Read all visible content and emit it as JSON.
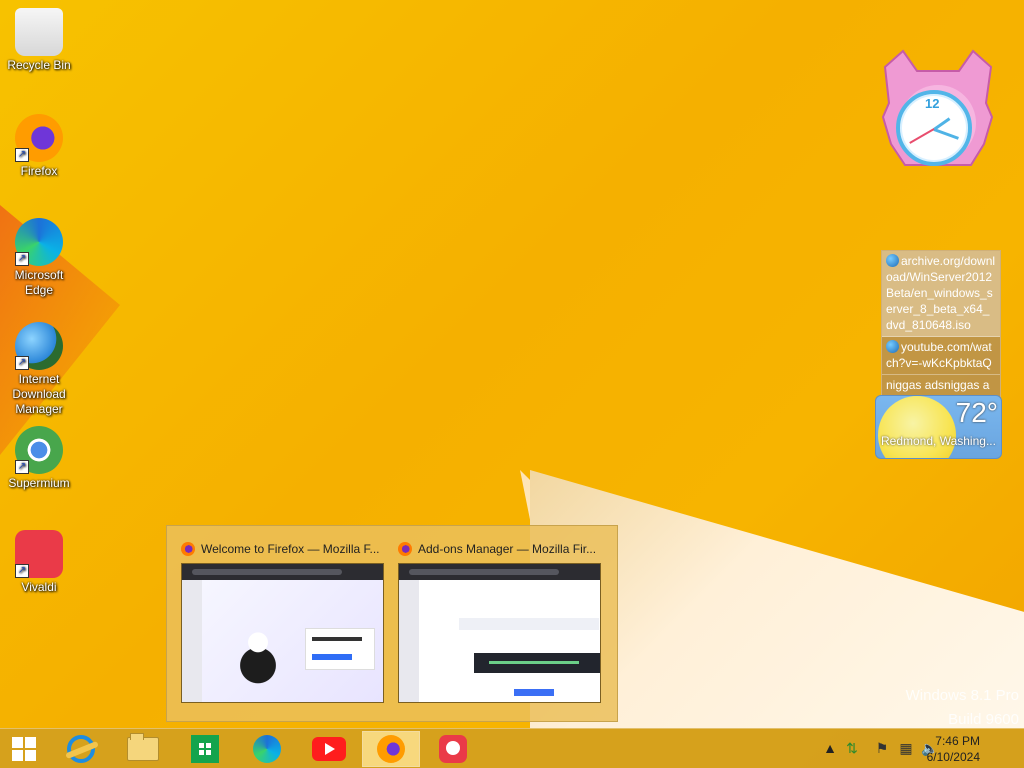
{
  "desktop": {
    "icons": [
      {
        "label": "Recycle Bin",
        "icon": "recycle-bin-icon"
      },
      {
        "label": "Firefox",
        "icon": "firefox-icon"
      },
      {
        "label": "Microsoft Edge",
        "icon": "edge-icon"
      },
      {
        "label": "Internet Download Manager",
        "icon": "download-manager-icon"
      },
      {
        "label": "Supermium",
        "icon": "supermium-icon"
      },
      {
        "label": "Vivaldi",
        "icon": "vivaldi-icon"
      }
    ]
  },
  "widgets": {
    "clock": {
      "number": "12"
    },
    "feed": {
      "items": [
        "archive.org/download/WinServer2012Beta/en_windows_server_8_beta_x64_dvd_810648.iso",
        "youtube.com/watch?v=-wKcKpbktaQ",
        "niggas adsniggas ads"
      ]
    },
    "weather": {
      "temperature": "72°",
      "location": "Redmond, Washing..."
    }
  },
  "popup": {
    "windows": [
      {
        "title": "Welcome to Firefox — Mozilla F..."
      },
      {
        "title": "Add-ons Manager — Mozilla Fir..."
      }
    ]
  },
  "watermark": {
    "line1": "Windows 8.1 Pro",
    "line2": "Build 9600"
  },
  "taskbar": {
    "time": "7:46 PM",
    "date": "6/10/2024",
    "tray_up": "▲"
  }
}
